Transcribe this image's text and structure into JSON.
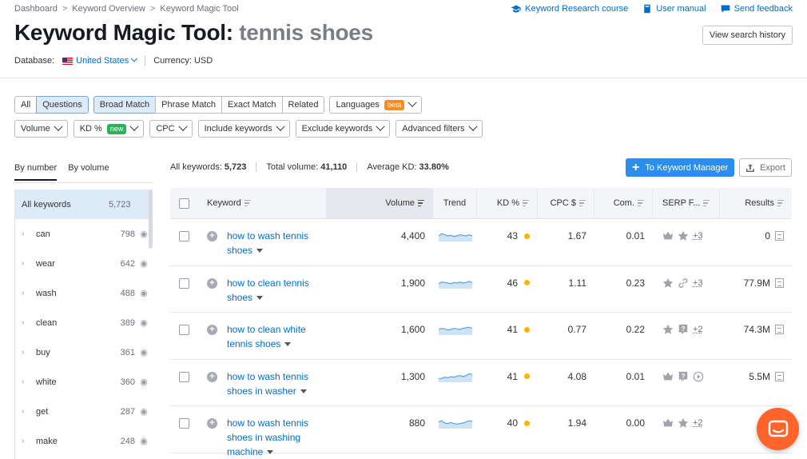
{
  "breadcrumb": [
    "Dashboard",
    "Keyword Overview",
    "Keyword Magic Tool"
  ],
  "top_links": {
    "course": "Keyword Research course",
    "manual": "User manual",
    "feedback": "Send feedback"
  },
  "title": {
    "main": "Keyword Magic Tool:",
    "query": "tennis shoes"
  },
  "view_history": "View search history",
  "database": {
    "label": "Database:",
    "value": "United States",
    "currency": "Currency: USD"
  },
  "match_tabs": [
    "All",
    "Questions",
    "Broad Match",
    "Phrase Match",
    "Exact Match",
    "Related"
  ],
  "languages": {
    "label": "Languages",
    "badge": "beta"
  },
  "filters": {
    "volume": "Volume",
    "kd": "KD %",
    "kd_badge": "new",
    "cpc": "CPC",
    "include": "Include keywords",
    "exclude": "Exclude keywords",
    "advanced": "Advanced filters"
  },
  "group_tabs": {
    "by_number": "By number",
    "by_volume": "By volume"
  },
  "stats": {
    "all_label": "All keywords:",
    "all_value": "5,723",
    "vol_label": "Total volume:",
    "vol_value": "41,110",
    "kd_label": "Average KD:",
    "kd_value": "33.80%"
  },
  "actions": {
    "to_manager": "To Keyword Manager",
    "export": "Export"
  },
  "sidebar": {
    "all": {
      "label": "All keywords",
      "count": "5,723"
    },
    "items": [
      {
        "label": "can",
        "count": "798"
      },
      {
        "label": "wear",
        "count": "642"
      },
      {
        "label": "wash",
        "count": "488"
      },
      {
        "label": "clean",
        "count": "389"
      },
      {
        "label": "buy",
        "count": "361"
      },
      {
        "label": "white",
        "count": "360"
      },
      {
        "label": "get",
        "count": "287"
      },
      {
        "label": "make",
        "count": "248"
      }
    ]
  },
  "table": {
    "headers": {
      "keyword": "Keyword",
      "volume": "Volume",
      "trend": "Trend",
      "kd": "KD %",
      "cpc": "CPC $",
      "com": "Com.",
      "serp": "SERP F...",
      "results": "Results"
    },
    "rows": [
      {
        "keyword": "how to wash tennis shoes",
        "volume": "4,400",
        "kd": "43",
        "cpc": "1.67",
        "com": "0.01",
        "serp": [
          "crown-icon",
          "star-icon"
        ],
        "more": "+3",
        "results": "0",
        "trend": [
          0.5,
          0.7,
          0.6,
          0.5,
          0.55,
          0.45,
          0.5,
          0.6,
          0.55,
          0.5,
          0.6,
          0.5
        ]
      },
      {
        "keyword": "how to clean tennis shoes",
        "volume": "1,900",
        "kd": "46",
        "cpc": "1.11",
        "com": "0.23",
        "serp": [
          "star-icon",
          "link-icon"
        ],
        "more": "+3",
        "results": "77.9M",
        "trend": [
          0.45,
          0.6,
          0.55,
          0.5,
          0.45,
          0.55,
          0.5,
          0.6,
          0.5,
          0.55,
          0.65,
          0.55
        ]
      },
      {
        "keyword": "how to clean white tennis shoes",
        "volume": "1,600",
        "kd": "41",
        "cpc": "0.77",
        "com": "0.22",
        "serp": [
          "star-icon",
          "question-icon"
        ],
        "more": "+2",
        "results": "74.3M",
        "trend": [
          0.5,
          0.6,
          0.55,
          0.45,
          0.5,
          0.6,
          0.55,
          0.5,
          0.6,
          0.65,
          0.7,
          0.6
        ]
      },
      {
        "keyword": "how to wash tennis shoes in washer",
        "volume": "1,300",
        "kd": "41",
        "cpc": "4.08",
        "com": "0.01",
        "serp": [
          "crown-icon",
          "question-icon",
          "play-icon"
        ],
        "more": "",
        "results": "5.5M",
        "trend": [
          0.3,
          0.35,
          0.45,
          0.4,
          0.5,
          0.45,
          0.55,
          0.6,
          0.5,
          0.6,
          0.75,
          0.7
        ]
      },
      {
        "keyword": "how to wash tennis shoes in washing machine",
        "volume": "880",
        "kd": "40",
        "cpc": "1.94",
        "com": "0.00",
        "serp": [
          "crown-icon",
          "star-icon"
        ],
        "more": "+2",
        "results": "11.2",
        "trend": [
          0.6,
          0.7,
          0.5,
          0.45,
          0.55,
          0.45,
          0.4,
          0.45,
          0.5,
          0.6,
          0.7,
          0.65
        ]
      }
    ]
  }
}
